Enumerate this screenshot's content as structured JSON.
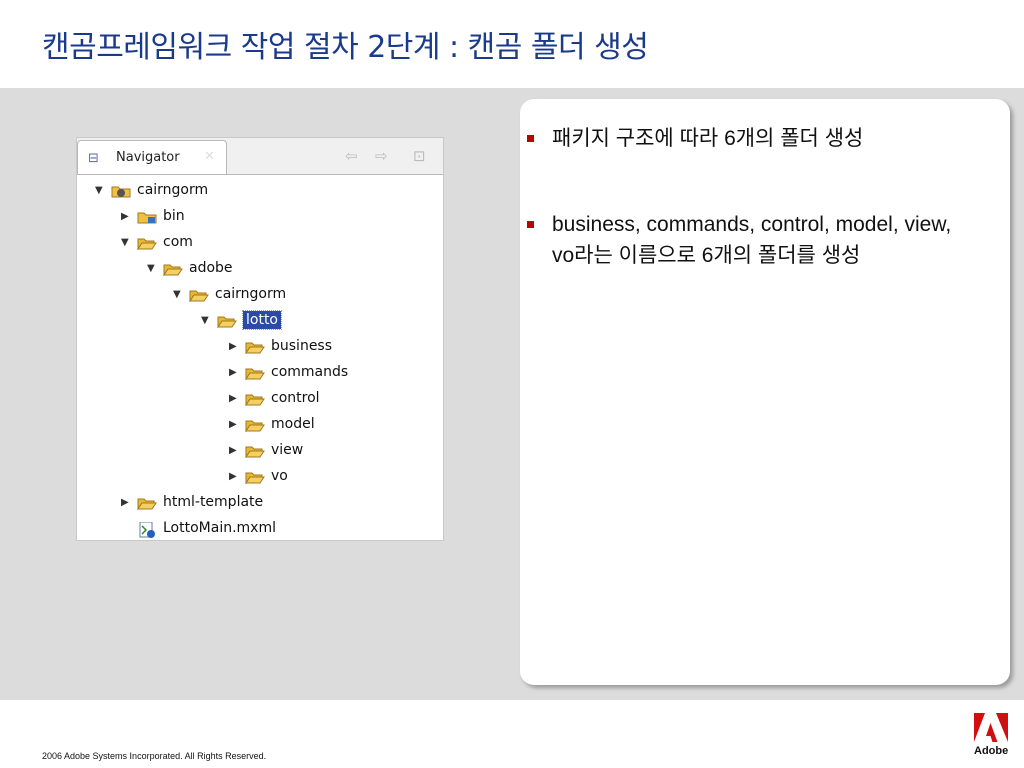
{
  "slide": {
    "title": "캔곰프레임워크 작업 절차 2단계 : 캔곰 폴더 생성"
  },
  "navigator": {
    "tab_label": "Navigator",
    "tab_icon": "navigator-icon",
    "close_icon": "close-icon",
    "toolbar_icons": [
      "back-arrow-icon",
      "forward-arrow-icon",
      "up-folder-icon"
    ],
    "tree": [
      {
        "label": "cairngorm",
        "expanded": true,
        "icon": "flex-project-icon"
      },
      {
        "label": "bin",
        "expanded": false,
        "icon": "bin-folder-icon"
      },
      {
        "label": "com",
        "expanded": true,
        "icon": "folder-icon"
      },
      {
        "label": "adobe",
        "expanded": true,
        "icon": "folder-icon"
      },
      {
        "label": "cairngorm",
        "expanded": true,
        "icon": "folder-icon"
      },
      {
        "label": "lotto",
        "expanded": true,
        "icon": "folder-icon",
        "selected": true
      },
      {
        "label": "business",
        "expanded": false,
        "icon": "folder-icon"
      },
      {
        "label": "commands",
        "expanded": false,
        "icon": "folder-icon"
      },
      {
        "label": "control",
        "expanded": false,
        "icon": "folder-icon"
      },
      {
        "label": "model",
        "expanded": false,
        "icon": "folder-icon"
      },
      {
        "label": "view",
        "expanded": false,
        "icon": "folder-icon"
      },
      {
        "label": "vo",
        "expanded": false,
        "icon": "folder-icon"
      },
      {
        "label": "html-template",
        "expanded": false,
        "icon": "folder-icon"
      },
      {
        "label": "LottoMain.mxml",
        "icon": "mxml-file-icon"
      }
    ]
  },
  "notes": {
    "bullets": [
      "패키지 구조에 따라 6개의 폴더 생성",
      "business, commands, control, model, view, vo라는 이름으로 6개의 폴더를 생성"
    ]
  },
  "footer": {
    "copyright": "2006 Adobe Systems Incorporated.  All Rights Reserved.",
    "logo_text": "Adobe"
  },
  "colors": {
    "title": "#1a3a8c",
    "bullet_marker": "#c00000",
    "selection": "#2b4aa8",
    "folder": "#f0c040"
  }
}
